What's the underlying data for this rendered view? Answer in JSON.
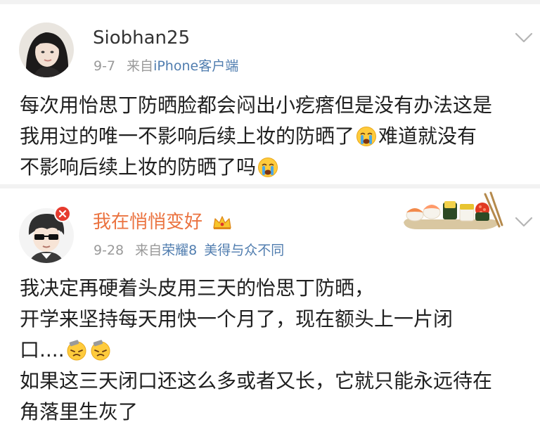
{
  "posts": [
    {
      "username": "Siobhan25",
      "date": "9-7",
      "source_prefix": "来自",
      "source_link": "iPhone客户端",
      "lines": [
        "每次用怡思丁防晒脸都会闷出小疙瘩但是没有办法这是",
        "我用过的唯一不影响后续上妆的防晒了",
        "难道就没有",
        "不影响后续上妆的防晒了吗"
      ],
      "icons": {
        "avatar": "user-avatar-photo",
        "menu": "chevron-down-icon",
        "emoji": "crying-face-emoji"
      }
    },
    {
      "username": "我在悄悄变好",
      "date": "9-28",
      "source_prefix": "来自",
      "source_link": "荣耀8",
      "source_tail": "美得与众不同",
      "lines": [
        "我决定再硬着头皮用三天的怡思丁防晒，",
        "开学来坚持每天用快一个月了，现在额头上一片闭",
        "口....",
        "如果这三天闭口还这么多或者又长，它就只能永远待在",
        "角落里生灰了"
      ],
      "icons": {
        "avatar": "user-avatar-cartoon",
        "badge": "vip-badge-icon",
        "crown": "crown-icon",
        "decoration": "sushi-card-decoration",
        "menu": "chevron-down-icon",
        "emoji": "sweating-face-emoji"
      }
    }
  ],
  "colors": {
    "username_vip": "#eb7340",
    "link": "#507daf",
    "meta": "#9a9a9a",
    "text": "#1f1f1f",
    "divider": "#f2f2f2"
  }
}
